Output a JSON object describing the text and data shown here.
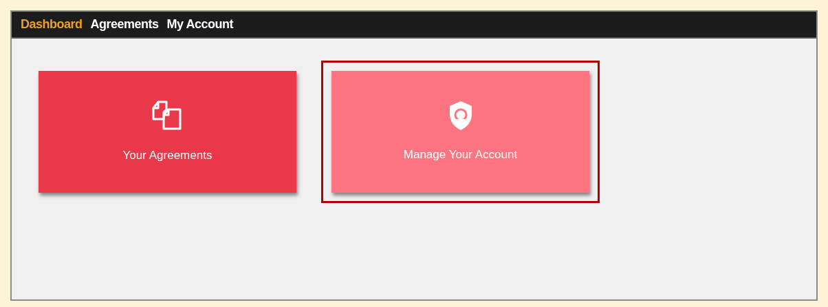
{
  "nav": [
    {
      "label": "Dashboard",
      "selected": true
    },
    {
      "label": "Agreements",
      "selected": false
    },
    {
      "label": "My Account",
      "selected": false
    }
  ],
  "tiles": [
    {
      "kind": "documents",
      "label": "Your Agreements",
      "selected": false
    },
    {
      "kind": "shield",
      "label": "Manage Your Account",
      "selected": true
    }
  ]
}
